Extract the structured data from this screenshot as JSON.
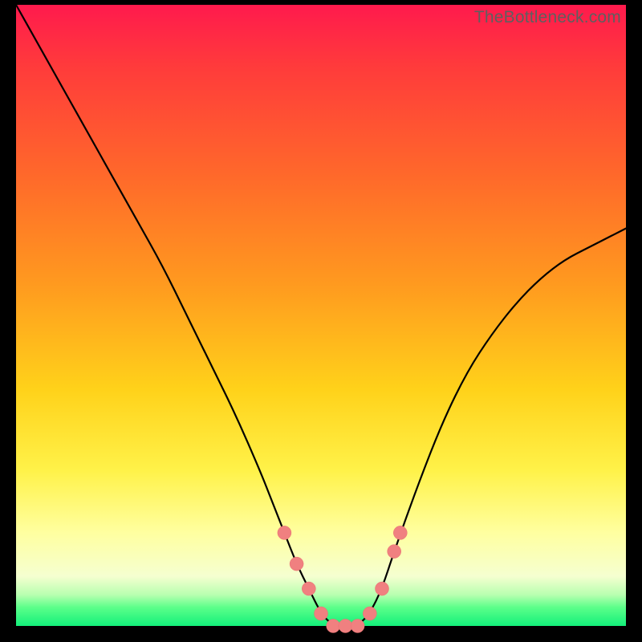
{
  "watermark": "TheBottleneck.com",
  "axes": {
    "x_range": [
      0,
      100
    ],
    "y_range": [
      0,
      100
    ],
    "grid": false
  },
  "colors": {
    "curve": "#000000",
    "dot": "#f08080",
    "gradient_top": "#ff1a4d",
    "gradient_bottom": "#13ef7a",
    "frame": "#000000"
  },
  "chart_data": {
    "type": "line",
    "title": "",
    "xlabel": "",
    "ylabel": "",
    "ylim": [
      0,
      100
    ],
    "xlim": [
      0,
      100
    ],
    "series": [
      {
        "name": "bottleneck-curve",
        "x": [
          0,
          4,
          8,
          12,
          16,
          20,
          24,
          28,
          32,
          36,
          40,
          42,
          44,
          46,
          48,
          50,
          52,
          54,
          56,
          58,
          60,
          62,
          66,
          70,
          74,
          78,
          82,
          86,
          90,
          94,
          98,
          100
        ],
        "y": [
          100,
          93,
          86,
          79,
          72,
          65,
          58,
          50,
          42,
          34,
          25,
          20,
          15,
          10,
          6,
          2,
          0,
          0,
          0,
          2,
          6,
          12,
          23,
          33,
          41,
          47,
          52,
          56,
          59,
          61,
          63,
          64
        ]
      }
    ],
    "highlight_points": {
      "name": "selected-range",
      "x": [
        44,
        46,
        48,
        50,
        52,
        54,
        56,
        58,
        60,
        62,
        63
      ],
      "y": [
        15,
        10,
        6,
        2,
        0,
        0,
        0,
        2,
        6,
        12,
        15
      ]
    }
  }
}
